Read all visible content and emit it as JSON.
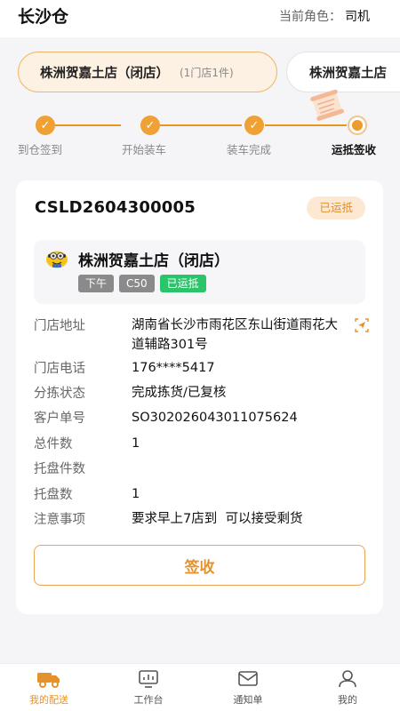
{
  "header": {
    "title": "长沙仓",
    "role_label": "当前角色：",
    "role_value": "司机"
  },
  "store_tabs": [
    {
      "name": "株洲贺嘉土店（闭店）",
      "meta": "(1门店1件)",
      "active": true
    },
    {
      "name": "株洲贺嘉土店",
      "meta": "",
      "active": false
    }
  ],
  "steps": [
    {
      "label": "到仓签到",
      "state": "done"
    },
    {
      "label": "开始装车",
      "state": "done"
    },
    {
      "label": "装车完成",
      "state": "done"
    },
    {
      "label": "运抵签收",
      "state": "current"
    }
  ],
  "order": {
    "number": "CSLD2604300005",
    "status": "已运抵",
    "store_name": "株洲贺嘉土店（闭店）",
    "tags": [
      "下午",
      "C50",
      "已运抵"
    ],
    "fields": {
      "address": {
        "label": "门店地址",
        "value": "湖南省长沙市雨花区东山街道雨花大道辅路301号"
      },
      "phone": {
        "label": "门店电话",
        "value": "176****5417"
      },
      "sort_status": {
        "label": "分拣状态",
        "value": "完成拣货/已复核"
      },
      "customer_no": {
        "label": "客户单号",
        "value": "SO302026043011075624"
      },
      "total_pieces": {
        "label": "总件数",
        "value": "1"
      },
      "pallet_pieces": {
        "label": "托盘件数",
        "value": ""
      },
      "pallet_count": {
        "label": "托盘数",
        "value": "1"
      },
      "notes": {
        "label": "注意事项",
        "value": "要求早上7店到  可以接受剩货"
      }
    },
    "sign_button": "签收"
  },
  "tabbar": [
    {
      "label": "我的配送",
      "icon": "truck-icon",
      "active": true
    },
    {
      "label": "工作台",
      "icon": "monitor-icon",
      "active": false
    },
    {
      "label": "通知单",
      "icon": "mail-icon",
      "active": false
    },
    {
      "label": "我的",
      "icon": "user-icon",
      "active": false
    }
  ],
  "colors": {
    "accent": "#ee9a2c",
    "tag_green": "#2cc46a",
    "tag_gray": "#8a8a8a",
    "background": "#f5f5f7"
  }
}
